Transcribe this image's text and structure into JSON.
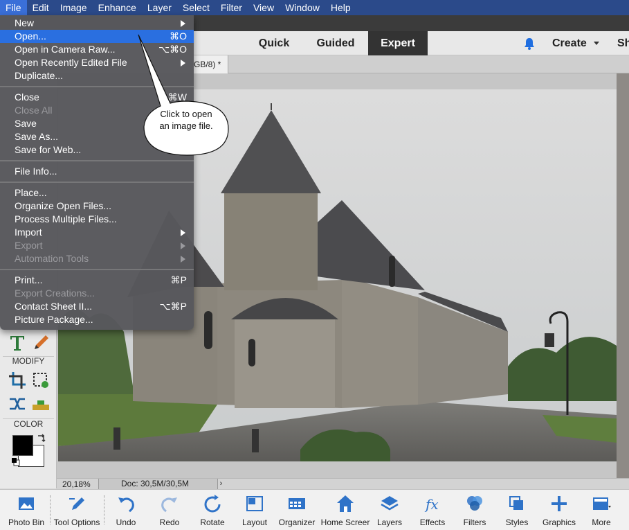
{
  "menubar": {
    "items": [
      "File",
      "Edit",
      "Image",
      "Enhance",
      "Layer",
      "Select",
      "Filter",
      "View",
      "Window",
      "Help"
    ]
  },
  "modes": {
    "quick": "Quick",
    "guided": "Guided",
    "expert": "Expert",
    "create": "Create",
    "share": "Sh"
  },
  "document_tab": {
    "title": "GB/8) *"
  },
  "file_menu": {
    "items": [
      {
        "label": "New",
        "shortcut": "",
        "submenu": true,
        "disabled": false
      },
      {
        "label": "Open...",
        "shortcut": "⌘O",
        "submenu": false,
        "disabled": false,
        "highlighted": true
      },
      {
        "label": "Open in Camera Raw...",
        "shortcut": "⌥⌘O",
        "submenu": false,
        "disabled": false
      },
      {
        "label": "Open Recently Edited File",
        "shortcut": "",
        "submenu": true,
        "disabled": false
      },
      {
        "label": "Duplicate...",
        "shortcut": "",
        "submenu": false,
        "disabled": false
      },
      {
        "label": "Close",
        "shortcut": "⌘W",
        "submenu": false,
        "disabled": false
      },
      {
        "label": "Close All",
        "shortcut": "",
        "submenu": false,
        "disabled": true
      },
      {
        "label": "Save",
        "shortcut": "",
        "submenu": false,
        "disabled": false
      },
      {
        "label": "Save As...",
        "shortcut": "",
        "submenu": false,
        "disabled": false
      },
      {
        "label": "Save for Web...",
        "shortcut": "⌥⌘",
        "submenu": false,
        "disabled": false
      },
      {
        "label": "File Info...",
        "shortcut": "",
        "submenu": false,
        "disabled": false
      },
      {
        "label": "Place...",
        "shortcut": "",
        "submenu": false,
        "disabled": false
      },
      {
        "label": "Organize Open Files...",
        "shortcut": "",
        "submenu": false,
        "disabled": false
      },
      {
        "label": "Process Multiple Files...",
        "shortcut": "",
        "submenu": false,
        "disabled": false
      },
      {
        "label": "Import",
        "shortcut": "",
        "submenu": true,
        "disabled": false
      },
      {
        "label": "Export",
        "shortcut": "",
        "submenu": true,
        "disabled": true
      },
      {
        "label": "Automation Tools",
        "shortcut": "",
        "submenu": true,
        "disabled": true
      },
      {
        "label": "Print...",
        "shortcut": "⌘P",
        "submenu": false,
        "disabled": false
      },
      {
        "label": "Export Creations...",
        "shortcut": "",
        "submenu": false,
        "disabled": true
      },
      {
        "label": "Contact Sheet II...",
        "shortcut": "⌥⌘P",
        "submenu": false,
        "disabled": false
      },
      {
        "label": "Picture Package...",
        "shortcut": "",
        "submenu": false,
        "disabled": false
      }
    ]
  },
  "callout": {
    "text": "Click to open an image file."
  },
  "toolbox": {
    "modify_label": "MODIFY",
    "color_label": "COLOR"
  },
  "status": {
    "zoom": "20,18%",
    "doc": "Doc: 30,5M/30,5M",
    "arrow": "›"
  },
  "bottom_bar": {
    "items": [
      {
        "label": "Photo Bin",
        "icon": "photo-bin-icon"
      },
      {
        "label": "Tool Options",
        "icon": "tool-options-icon"
      },
      {
        "label": "Undo",
        "icon": "undo-icon"
      },
      {
        "label": "Redo",
        "icon": "redo-icon"
      },
      {
        "label": "Rotate",
        "icon": "rotate-icon"
      },
      {
        "label": "Layout",
        "icon": "layout-icon"
      },
      {
        "label": "Organizer",
        "icon": "organizer-icon"
      },
      {
        "label": "Home Screer",
        "icon": "home-screen-icon"
      },
      {
        "label": "Layers",
        "icon": "layers-icon"
      },
      {
        "label": "Effects",
        "icon": "effects-icon"
      },
      {
        "label": "Filters",
        "icon": "filters-icon"
      },
      {
        "label": "Styles",
        "icon": "styles-icon"
      },
      {
        "label": "Graphics",
        "icon": "graphics-icon"
      },
      {
        "label": "More",
        "icon": "more-icon"
      }
    ]
  },
  "colors": {
    "menubar": "#2b4a8a",
    "highlight": "#2a6fe0",
    "accent_blue": "#2f73c8"
  }
}
